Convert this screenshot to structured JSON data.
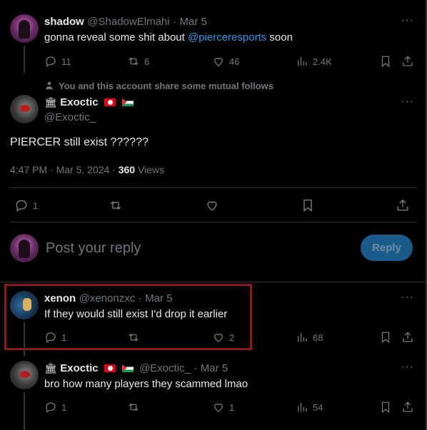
{
  "tweet1": {
    "name": "shadow",
    "handle": "@ShadowElmahi",
    "sep": "·",
    "date": "Mar 5",
    "text_before": "gonna reveal some shit about ",
    "mention": "@pierceresports",
    "text_after": " soon",
    "replies": "11",
    "retweets": "6",
    "likes": "46",
    "views": "2.4K"
  },
  "main": {
    "mutual_notice": "You and this account share some mutual follows",
    "name": "Exoctic",
    "handle": "@Exoctic_",
    "text": "PIERCER still exist ??????",
    "timestamp": "4:47 PM · Mar 5, 2024 · ",
    "views_count": "360",
    "views_label": " Views",
    "replies": "1"
  },
  "composer": {
    "placeholder": "Post your reply",
    "button": "Reply"
  },
  "reply1": {
    "name": "xenon",
    "handle": "@xenonzxc",
    "sep": "·",
    "date": "Mar 5",
    "text": "If they would still exist I'd drop it earlier",
    "replies": "1",
    "likes": "2",
    "views": "68"
  },
  "reply2": {
    "name": "Exoctic",
    "handle": "@Exoctic_",
    "sep": "·",
    "date": "Mar 5",
    "text": "bro how many players they scammed lmao",
    "replies": "1",
    "likes": "1",
    "views": "54"
  },
  "colors": {
    "highlight_border": "#8b1a1a",
    "link": "#1d9bf0",
    "reply_button": "#1a5b8c"
  }
}
